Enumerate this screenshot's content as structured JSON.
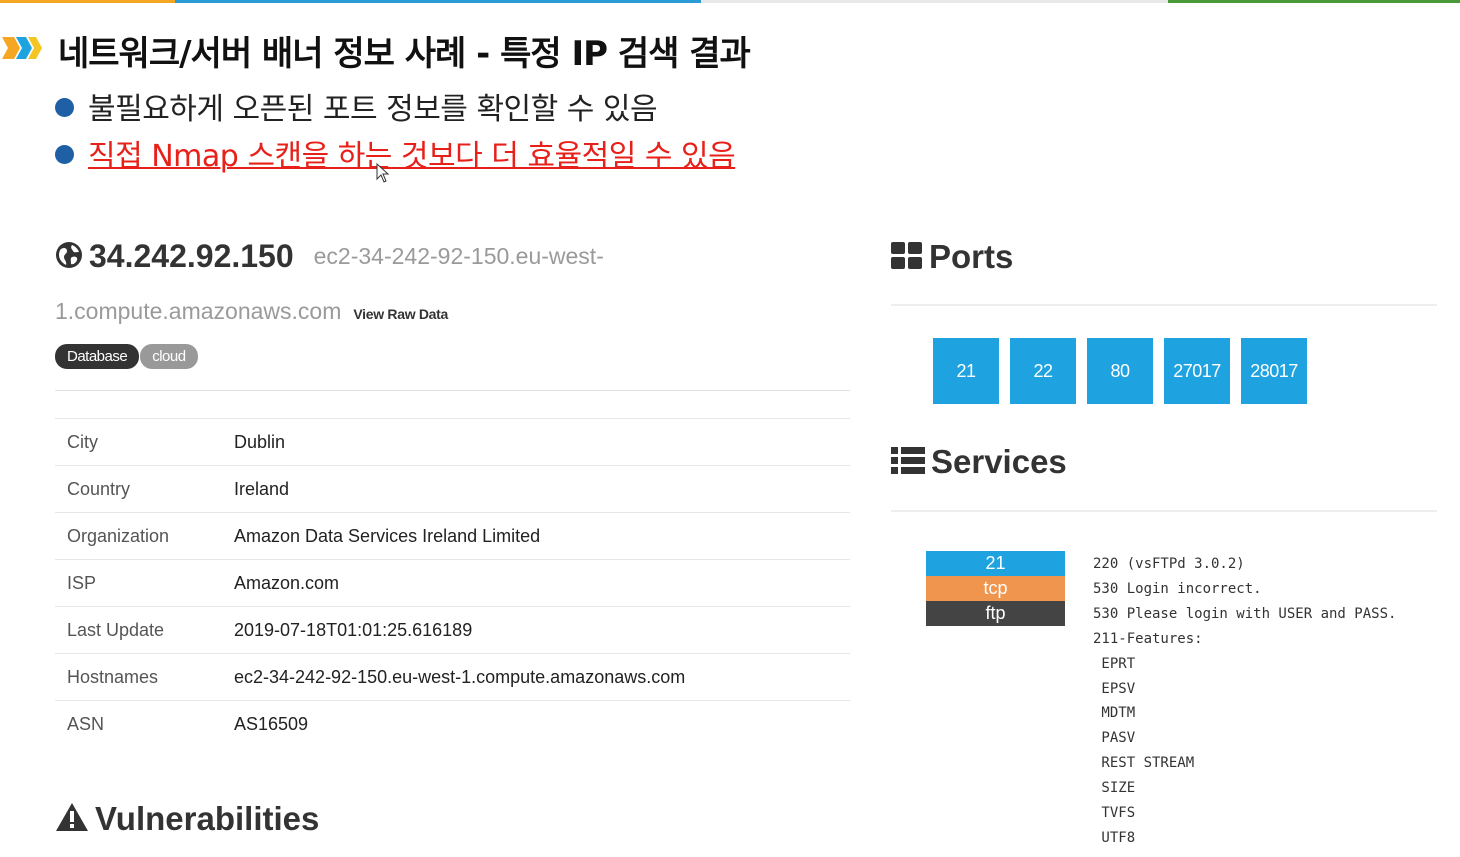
{
  "slide": {
    "title": "네트워크/서버 배너 정보 사례 - 특정 IP 검색 결과",
    "bullets": [
      "불필요하게 오픈된 포트 정보를 확인할 수 있음",
      "직접 Nmap 스캔을 하는 것보다 더 효율적일 수 있음"
    ],
    "colors": {
      "bullet_dot": "#1f5fa6",
      "highlight_text": "#e8201a"
    }
  },
  "host": {
    "ip": "34.242.92.150",
    "hostname_line1": "ec2-34-242-92-150.eu-west-",
    "hostname_line2": "1.compute.amazonaws.com",
    "raw_link": "View Raw Data",
    "tags": [
      "Database",
      "cloud"
    ]
  },
  "info": {
    "rows": [
      {
        "key": "City",
        "value": "Dublin"
      },
      {
        "key": "Country",
        "value": "Ireland"
      },
      {
        "key": "Organization",
        "value": "Amazon Data Services Ireland Limited"
      },
      {
        "key": "ISP",
        "value": "Amazon.com"
      },
      {
        "key": "Last Update",
        "value": "2019-07-18T01:01:25.616189"
      },
      {
        "key": "Hostnames",
        "value": "ec2-34-242-92-150.eu-west-1.compute.amazonaws.com"
      },
      {
        "key": "ASN",
        "value": "AS16509"
      }
    ]
  },
  "vulnerabilities": {
    "title": "Vulnerabilities"
  },
  "ports": {
    "title": "Ports",
    "list": [
      "21",
      "22",
      "80",
      "27017",
      "28017"
    ],
    "color": "#1ea2e0"
  },
  "services": {
    "title": "Services",
    "items": [
      {
        "port": "21",
        "protocol": "tcp",
        "name": "ftp",
        "banner": "220 (vsFTPd 3.0.2)\n530 Login incorrect.\n530 Please login with USER and PASS.\n211-Features:\n EPRT\n EPSV\n MDTM\n PASV\n REST STREAM\n SIZE\n TVFS\n UTF8"
      }
    ],
    "colors": {
      "port": "#1ea2e0",
      "protocol": "#f0954e",
      "name": "#444444"
    }
  }
}
